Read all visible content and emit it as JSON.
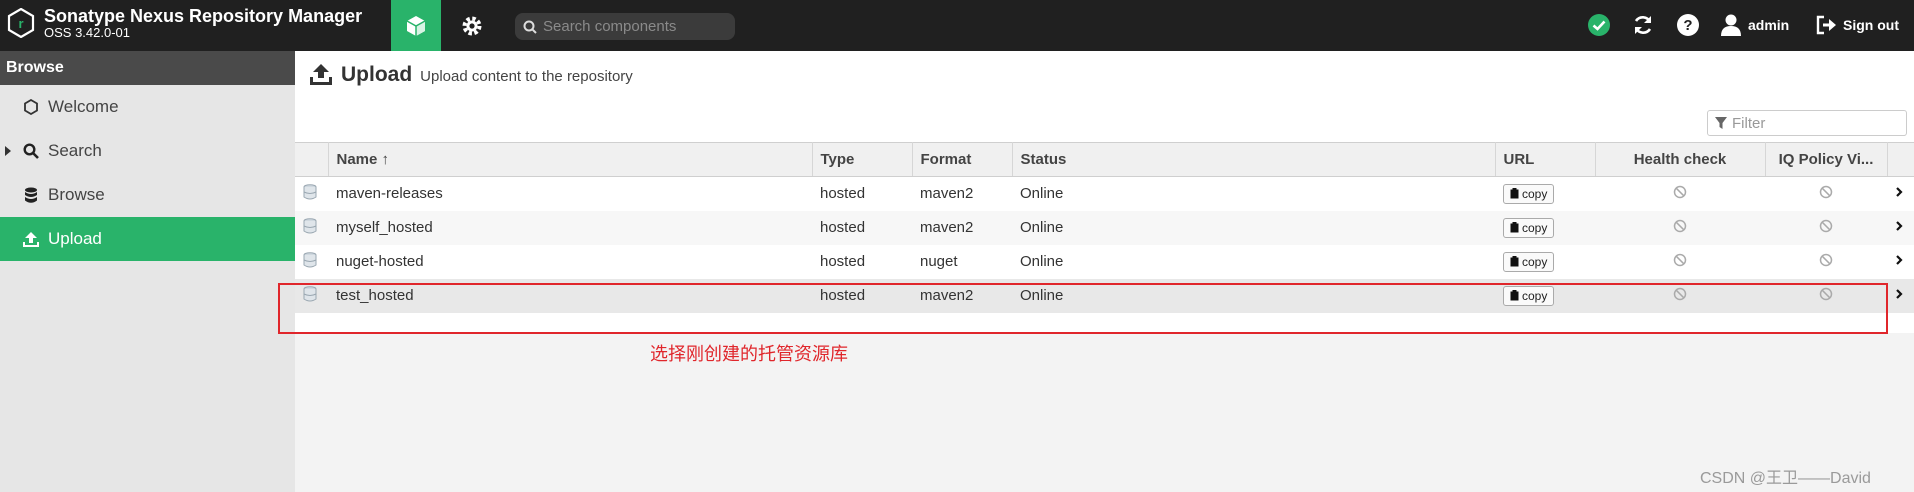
{
  "header": {
    "app_title": "Sonatype Nexus Repository Manager",
    "version": "OSS 3.42.0-01",
    "search_placeholder": "Search components",
    "user": "admin",
    "signout": "Sign out"
  },
  "sidebar": {
    "section": "Browse",
    "items": [
      {
        "label": "Welcome",
        "icon": "hexagon-icon"
      },
      {
        "label": "Search",
        "icon": "search-icon"
      },
      {
        "label": "Browse",
        "icon": "database-icon"
      },
      {
        "label": "Upload",
        "icon": "upload-icon",
        "active": true
      }
    ]
  },
  "page": {
    "title": "Upload",
    "subtitle": "Upload content to the repository",
    "filter_placeholder": "Filter"
  },
  "table": {
    "columns": [
      "Name ↑",
      "Type",
      "Format",
      "Status",
      "URL",
      "Health check",
      "IQ Policy Vi..."
    ],
    "copy_label": "copy",
    "rows": [
      {
        "name": "maven-releases",
        "type": "hosted",
        "format": "maven2",
        "status": "Online"
      },
      {
        "name": "myself_hosted",
        "type": "hosted",
        "format": "maven2",
        "status": "Online"
      },
      {
        "name": "nuget-hosted",
        "type": "hosted",
        "format": "nuget",
        "status": "Online"
      },
      {
        "name": "test_hosted",
        "type": "hosted",
        "format": "maven2",
        "status": "Online"
      }
    ]
  },
  "annotation": "选择刚创建的托管资源库",
  "watermark": "CSDN @王卫——David",
  "colors": {
    "accent": "#29b36a",
    "topbar": "#202020",
    "annotation": "#e0262b",
    "status_ok": "#29b36a"
  }
}
